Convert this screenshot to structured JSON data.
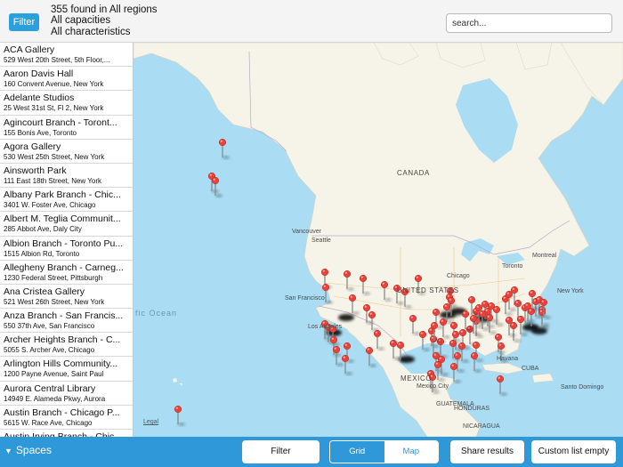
{
  "header": {
    "filter_label": "Filter",
    "summary_line1": "355 found in All regions",
    "summary_line2": "All capacities",
    "summary_line3": "All characteristics",
    "search_placeholder": "search..."
  },
  "list": [
    {
      "name": "ACA Gallery",
      "address": "529 West 20th Street, 5th Floor,..."
    },
    {
      "name": "Aaron Davis Hall",
      "address": "160 Convent Avenue, New York"
    },
    {
      "name": "Adelante Studios",
      "address": "25 West 31st St, Fl 2, New York"
    },
    {
      "name": "Agincourt Branch - Toront...",
      "address": "155 Bonis Ave, Toronto"
    },
    {
      "name": "Agora Gallery",
      "address": "530 West 25th Street, New York"
    },
    {
      "name": "Ainsworth Park",
      "address": "111 East 18th Street, New York"
    },
    {
      "name": "Albany Park Branch - Chic...",
      "address": "3401 W. Foster Ave, Chicago"
    },
    {
      "name": "Albert M. Teglia Communit...",
      "address": "285 Abbot Ave, Daly City"
    },
    {
      "name": "Albion Branch - Toronto Pu...",
      "address": "1515 Albion Rd, Toronto"
    },
    {
      "name": "Allegheny Branch - Carneg...",
      "address": "1230 Federal Street, Pittsburgh"
    },
    {
      "name": "Ana Cristea Gallery",
      "address": "521 West 26th Street, New York"
    },
    {
      "name": "Anza Branch - San Francis...",
      "address": "550 37th Ave, San Francisco"
    },
    {
      "name": "Archer Heights Branch - C...",
      "address": "5055 S. Archer Ave, Chicago"
    },
    {
      "name": "Arlington Hills Community...",
      "address": "1200 Payne Avenue, Saint Paul"
    },
    {
      "name": "Aurora Central Library",
      "address": "14949 E. Alameda Pkwy, Aurora"
    },
    {
      "name": "Austin Branch - Chicago P...",
      "address": "5615 W. Race Ave, Chicago"
    },
    {
      "name": "Austin Irving Branch - Chic...",
      "address": ""
    }
  ],
  "map": {
    "labels": {
      "canada": "CANADA",
      "united_states": "UNITED STATES",
      "mexico": "MEXICO",
      "ocean": "fic Ocean",
      "vancouver": "Vancouver",
      "seattle": "Seattle",
      "san_francisco": "San Francisco",
      "los_angeles": "Los Angeles",
      "chicago": "Chicago",
      "toronto": "Toronto",
      "montreal": "Montreal",
      "new_york": "New York",
      "havana": "Havana",
      "cuba": "CUBA",
      "mexico_city": "Mexico City",
      "guatemala": "GUATEMALA",
      "honduras": "HONDURAS",
      "nicaragua": "NICARAGUA",
      "santo_domingo": "Santo Domingo",
      "legal": "Legal"
    },
    "colors": {
      "water": "#aadcf3",
      "land": "#f6f4e9",
      "pin": "#e8423b"
    }
  },
  "footer": {
    "spaces_label": "Spaces",
    "filter_label": "Filter",
    "grid_label": "Grid",
    "map_label": "Map",
    "share_label": "Share results",
    "custom_list_label": "Custom list empty"
  }
}
